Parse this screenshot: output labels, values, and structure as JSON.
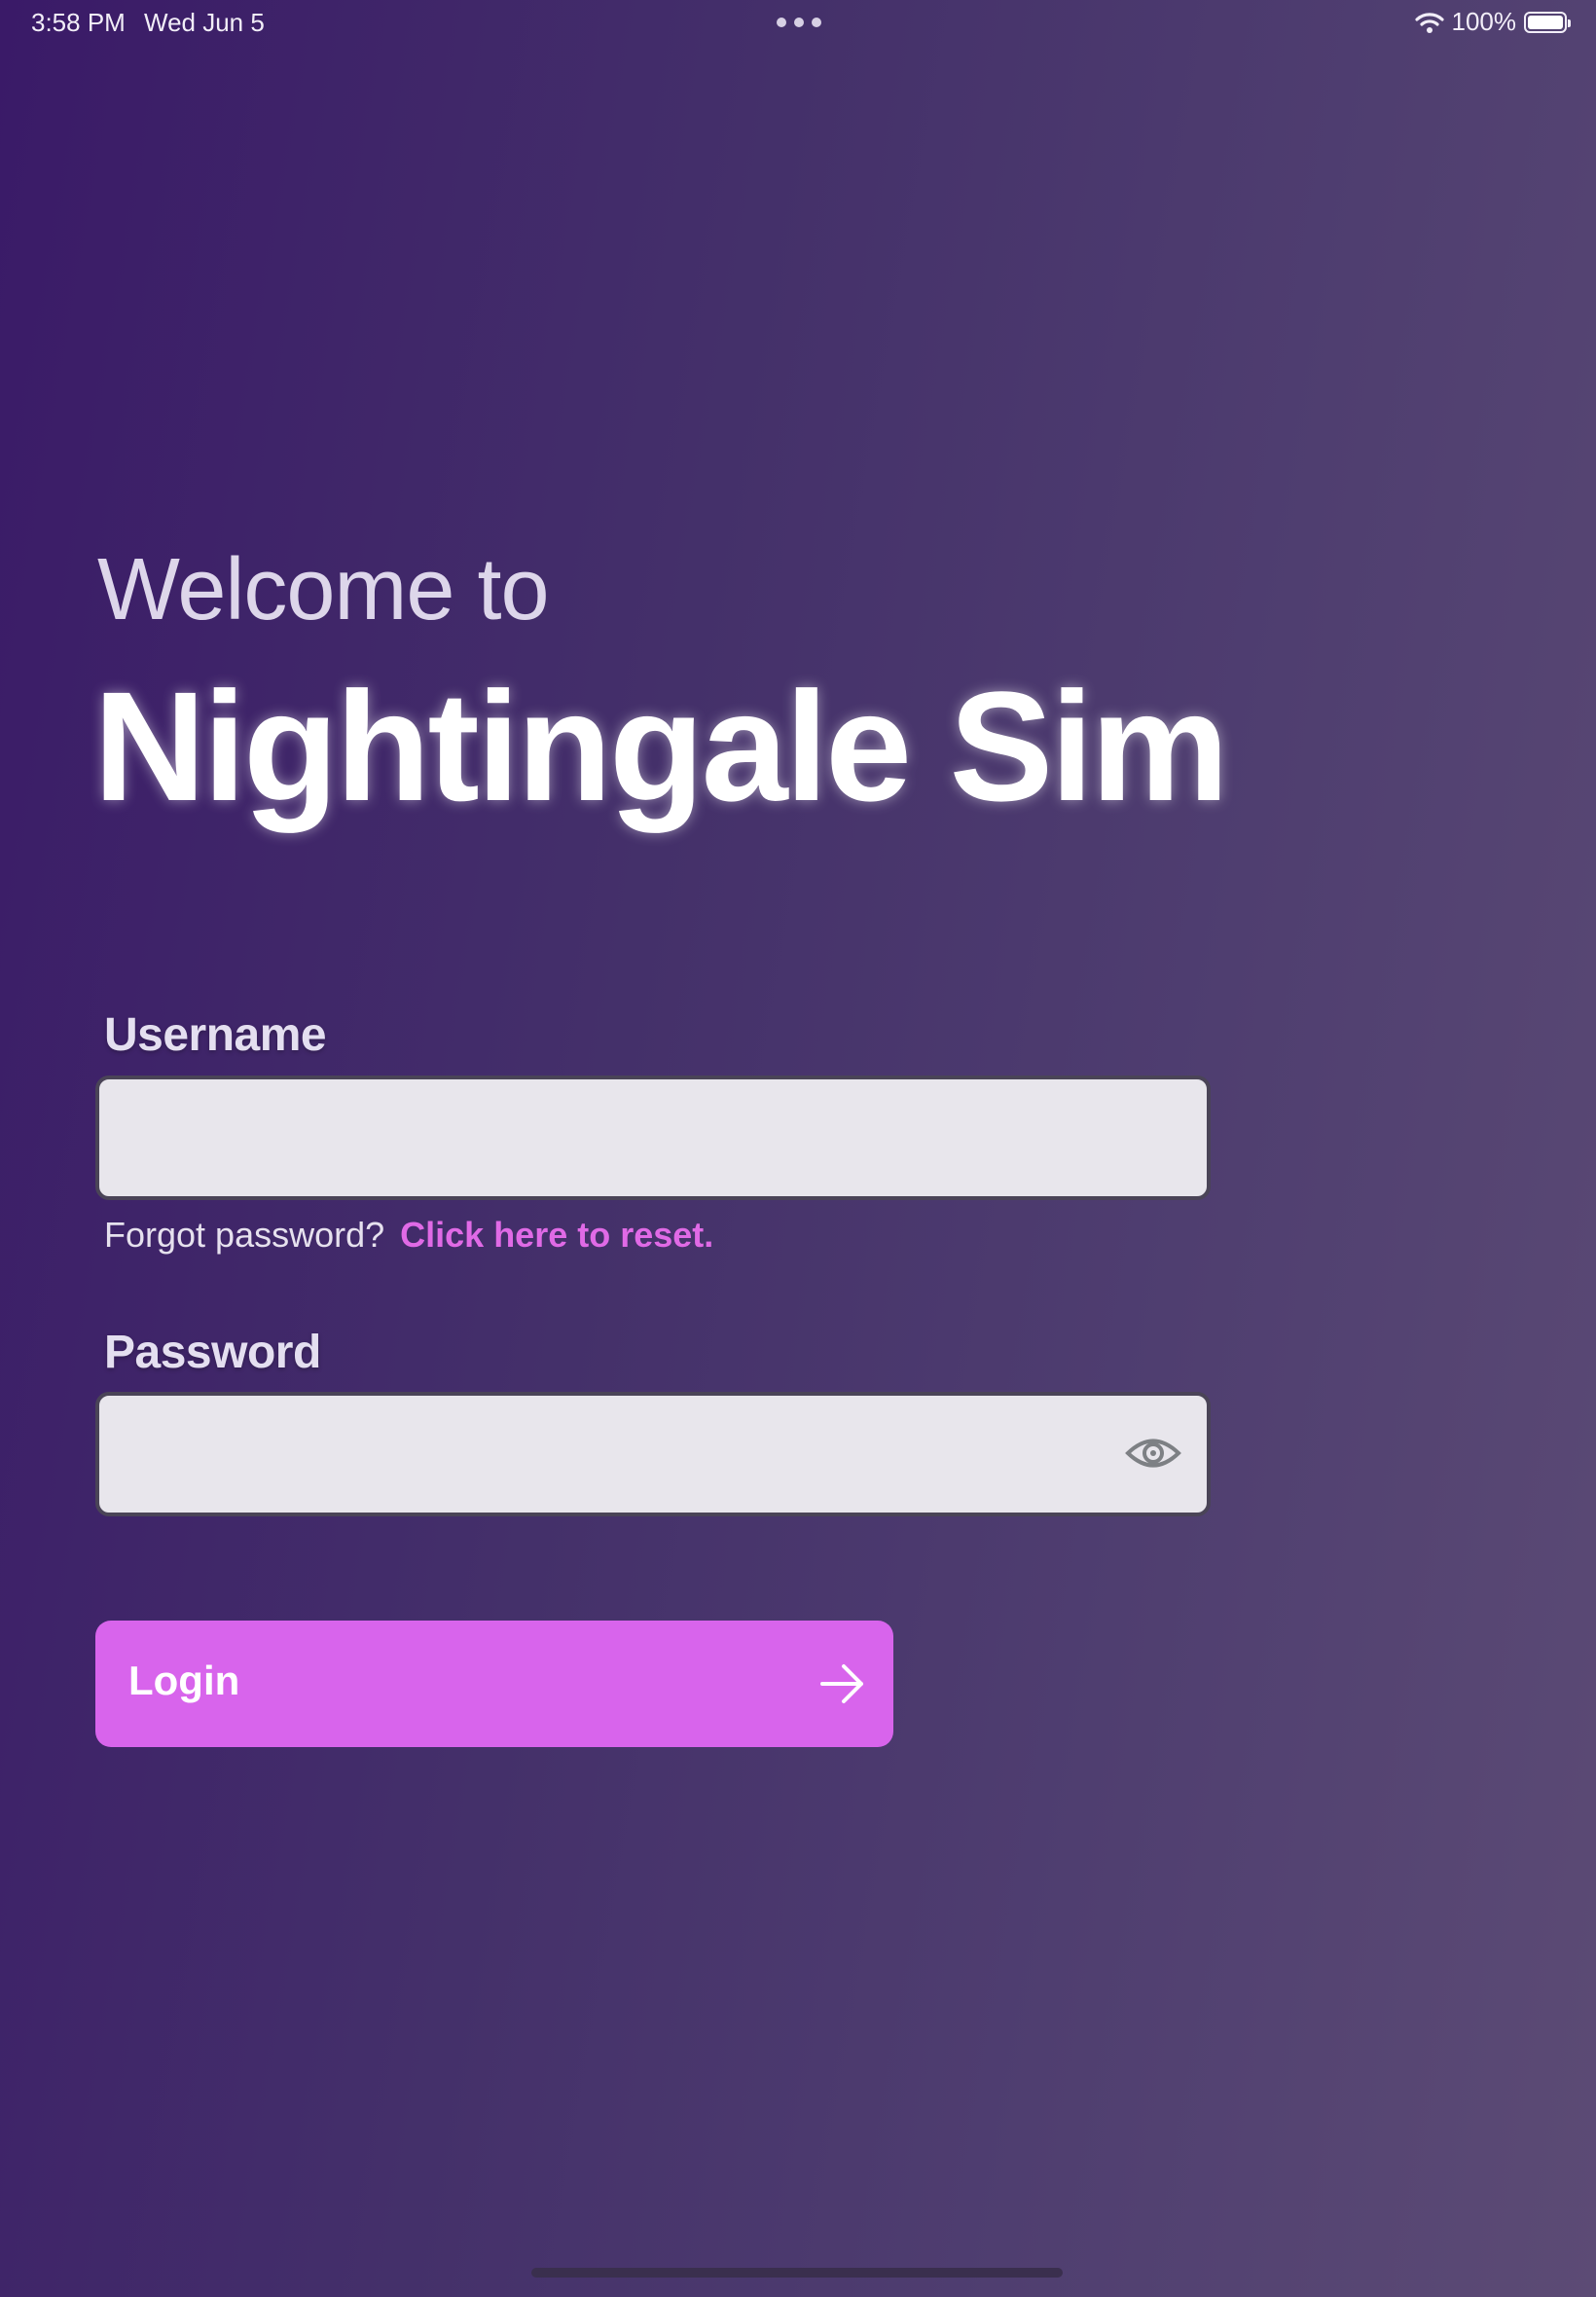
{
  "status_bar": {
    "time": "3:58 PM",
    "date": "Wed Jun 5",
    "battery": "100%",
    "wifi_icon": "wifi-icon",
    "battery_icon": "battery-icon"
  },
  "header": {
    "welcome": "Welcome to",
    "title": "Nightingale Sim"
  },
  "form": {
    "username_label": "Username",
    "username_value": "",
    "forgot_text": "Forgot password?",
    "reset_link": "Click here to reset.",
    "password_label": "Password",
    "password_value": "",
    "login_label": "Login"
  },
  "colors": {
    "accent": "#d864ec",
    "link": "#e06ae6",
    "field_bg": "#e8e6ec",
    "bg_start": "#3a1a68",
    "bg_end": "#5c4b75"
  }
}
